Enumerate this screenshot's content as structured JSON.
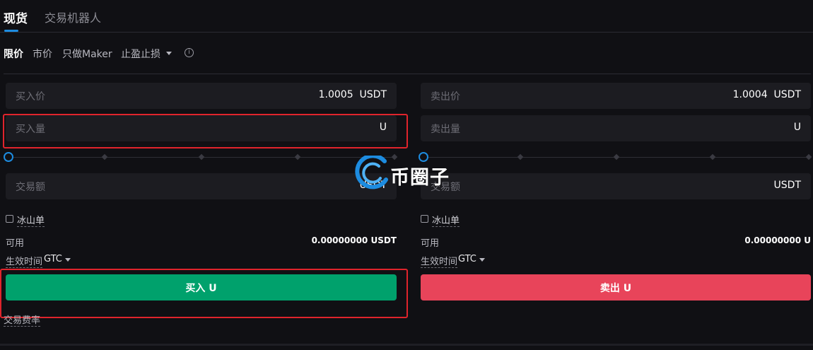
{
  "tabs": [
    {
      "label": "现货"
    },
    {
      "label": "交易机器人"
    }
  ],
  "order_types": [
    {
      "label": "限价"
    },
    {
      "label": "市价"
    },
    {
      "label": "只做Maker"
    },
    {
      "label": "止盈止损"
    }
  ],
  "info_icon_glyph": "i",
  "buy": {
    "price_placeholder": "买入价",
    "price_value": "1.0005",
    "price_unit": "USDT",
    "amount_placeholder": "买入量",
    "amount_unit": "U",
    "total_placeholder": "交易额",
    "total_unit": "USDT",
    "iceberg_label": "冰山单",
    "available_label": "可用",
    "available_value": "0.00000000 USDT",
    "tif_label": "生效时间",
    "tif_value": "GTC",
    "button_label": "买入 U",
    "fee_label": "交易费率",
    "slider_percent": 0
  },
  "sell": {
    "price_placeholder": "卖出价",
    "price_value": "1.0004",
    "price_unit": "USDT",
    "amount_placeholder": "卖出量",
    "amount_unit": "U",
    "total_placeholder": "交易额",
    "total_unit": "USDT",
    "iceberg_label": "冰山单",
    "available_label": "可用",
    "available_value": "0.00000000 U",
    "tif_label": "生效时间",
    "tif_value": "GTC",
    "button_label": "卖出 U",
    "slider_percent": 0
  },
  "watermark": {
    "text": "币圈子"
  },
  "colors": {
    "accent": "#1d8ce0",
    "buy": "#00a16c",
    "sell": "#e8445a",
    "highlight": "#e0242c",
    "background": "#101014"
  }
}
